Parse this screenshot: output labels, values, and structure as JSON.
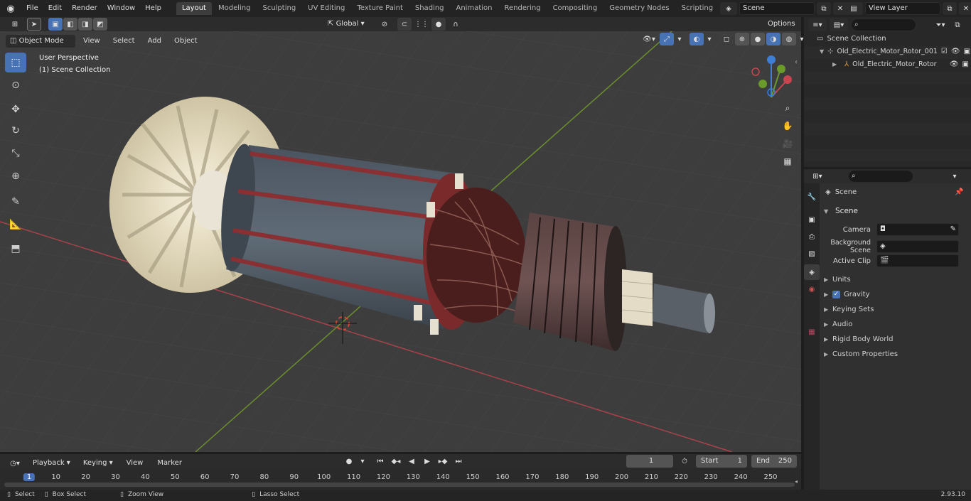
{
  "topbar": {
    "menus": [
      "File",
      "Edit",
      "Render",
      "Window",
      "Help"
    ],
    "workspaces": [
      "Layout",
      "Modeling",
      "Sculpting",
      "UV Editing",
      "Texture Paint",
      "Shading",
      "Animation",
      "Rendering",
      "Compositing",
      "Geometry Nodes",
      "Scripting"
    ],
    "active_workspace": "Layout",
    "scene_name": "Scene",
    "view_layer": "View Layer"
  },
  "viewport_header": {
    "mode": "Object Mode",
    "menus": [
      "View",
      "Select",
      "Add",
      "Object"
    ],
    "orientation": "Global",
    "options_label": "Options"
  },
  "viewport": {
    "perspective_label": "User Perspective",
    "collection_label": "(1) Scene Collection"
  },
  "outliner": {
    "root": "Scene Collection",
    "items": [
      {
        "label": "Old_Electric_Motor_Rotor_001"
      },
      {
        "label": "Old_Electric_Motor_Rotor"
      }
    ]
  },
  "properties": {
    "context": "Scene",
    "panel_title": "Scene",
    "fields": [
      {
        "label": "Camera"
      },
      {
        "label": "Background Scene"
      },
      {
        "label": "Active Clip"
      }
    ],
    "sections": [
      {
        "label": "Units"
      },
      {
        "label": "Gravity"
      },
      {
        "label": "Keying Sets"
      },
      {
        "label": "Audio"
      },
      {
        "label": "Rigid Body World"
      },
      {
        "label": "Custom Properties"
      }
    ],
    "gravity_checked": true
  },
  "timeline": {
    "menus": [
      "Playback",
      "Keying",
      "View",
      "Marker"
    ],
    "current_frame": "1",
    "start_label": "Start",
    "start": "1",
    "end_label": "End",
    "end": "250",
    "ticks": [
      "1",
      "10",
      "20",
      "30",
      "40",
      "50",
      "60",
      "70",
      "80",
      "90",
      "100",
      "110",
      "120",
      "130",
      "140",
      "150",
      "160",
      "170",
      "180",
      "190",
      "200",
      "210",
      "220",
      "230",
      "240",
      "250"
    ]
  },
  "statusbar": {
    "items": [
      "Select",
      "Box Select",
      "Zoom View",
      "Lasso Select"
    ],
    "version": "2.93.10"
  },
  "colors": {
    "accent": "#4772b3",
    "x_axis": "#c8454f",
    "y_axis": "#6a9a2a",
    "z_axis": "#3d7fd6"
  }
}
